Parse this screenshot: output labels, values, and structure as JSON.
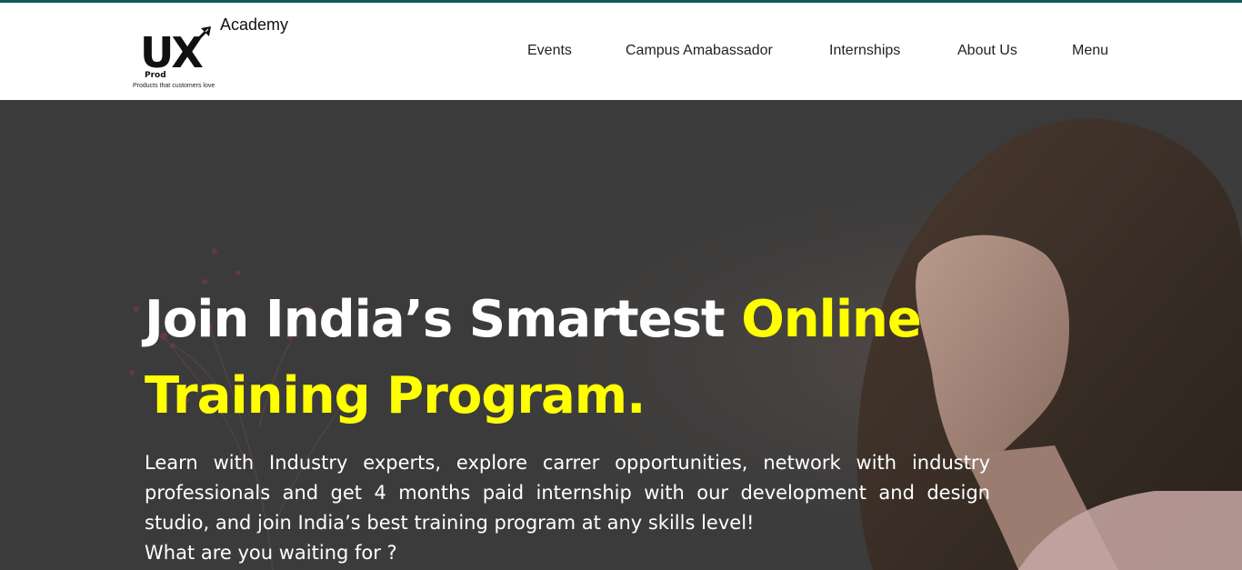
{
  "header": {
    "logo": {
      "mark": "UX",
      "prod": "Prod",
      "academy": "Academy",
      "tagline": "Products that customers love",
      "icon": "rocket-arrow-icon"
    },
    "nav": [
      {
        "label": "Events"
      },
      {
        "label": "Campus Amabassador"
      },
      {
        "label": "Internships"
      },
      {
        "label": "About Us"
      },
      {
        "label": "Menu"
      }
    ]
  },
  "hero": {
    "title_white": "Join India’s Smartest ",
    "title_accent_1": "Online",
    "title_accent_2": "Training Program.",
    "description": "Learn with Industry experts, explore carrer opportunities, network with industry professionals and get 4 months paid internship with our development and design studio, and join India’s best training program at any skills level!",
    "question": "What are you waiting for ?"
  },
  "colors": {
    "top_border": "#0f5b5b",
    "hero_background": "#3b3b3b",
    "accent": "#ffff00",
    "text_light": "#ffffff"
  }
}
